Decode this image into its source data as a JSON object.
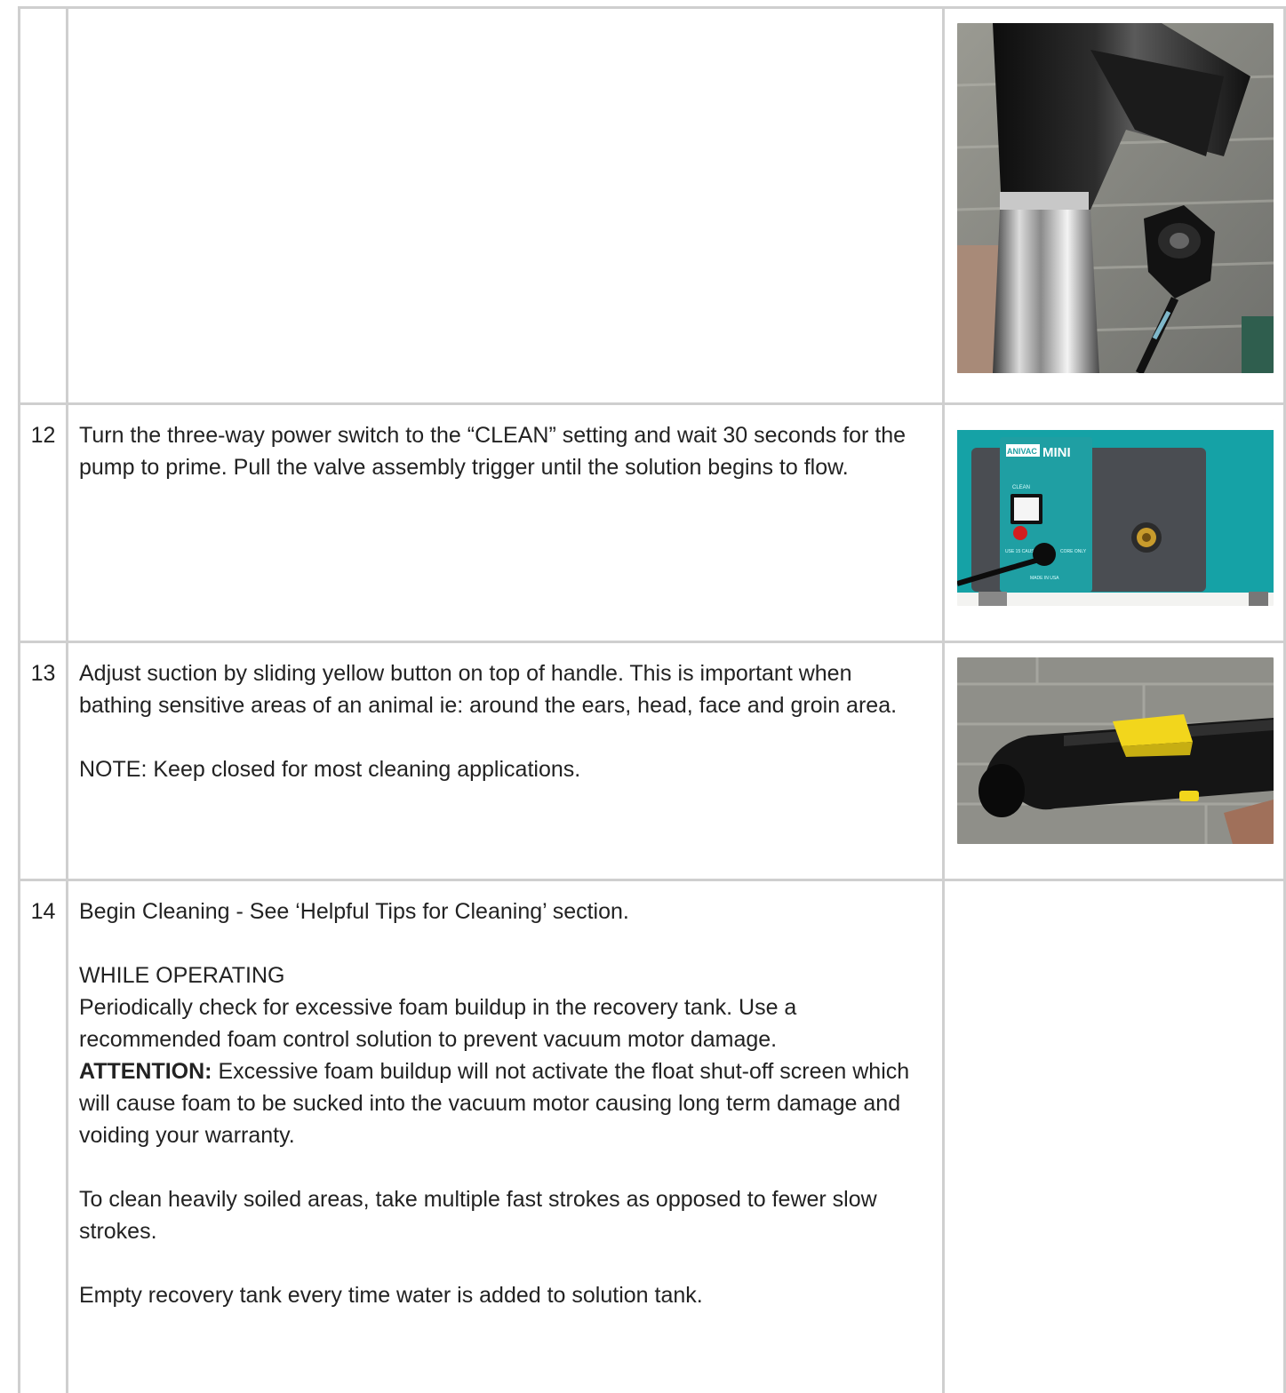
{
  "rows": [
    {
      "number": "",
      "text": [],
      "image": "nozzle-wand-photo"
    },
    {
      "number": "12",
      "text": [
        "Turn the three-way power switch to the “CLEAN” setting and wait 30 seconds for the pump to prime.  Pull the valve assembly trigger until the solution begins to flow."
      ],
      "image": "power-switch-panel-photo",
      "image_text": {
        "logo_left": "ANIVAC",
        "logo_right": "MINI",
        "switch_label": "CLEAN",
        "small_left": "USE 15 CAUSE",
        "small_right": "CORE ONLY",
        "made_in": "MADE IN USA"
      }
    },
    {
      "number": "13",
      "text": [
        "Adjust suction by sliding yellow button on top of handle.  This is important when bathing sensitive areas of an animal ie: around the ears, head, face and groin area."
      ],
      "note": "Keep closed for most cleaning applications.",
      "note_label": "NOTE:",
      "image": "handle-yellow-button-photo"
    },
    {
      "number": "14",
      "line1": "Begin Cleaning - See ‘Helpful Tips for Cleaning’ section.",
      "heading": "WHILE OPERATING",
      "para1": "Periodically check for excessive foam buildup in the recovery tank. Use a recommended foam control solution to prevent vacuum motor damage.",
      "attention_label": "ATTENTION:",
      "attention_text": " Excessive foam buildup will not activate the float shut-off screen which will cause foam to be sucked into the vacuum motor causing long term damage and voiding your warranty.",
      "para2": "To clean heavily soiled areas, take multiple fast strokes as opposed to fewer slow strokes.",
      "para3": "Empty recovery tank every time water is added to solution tank."
    }
  ],
  "colors": {
    "border": "#cfcfcf",
    "text": "#222222",
    "machine_teal": "#1aa6a8",
    "handle_yellow": "#f2d61c"
  }
}
